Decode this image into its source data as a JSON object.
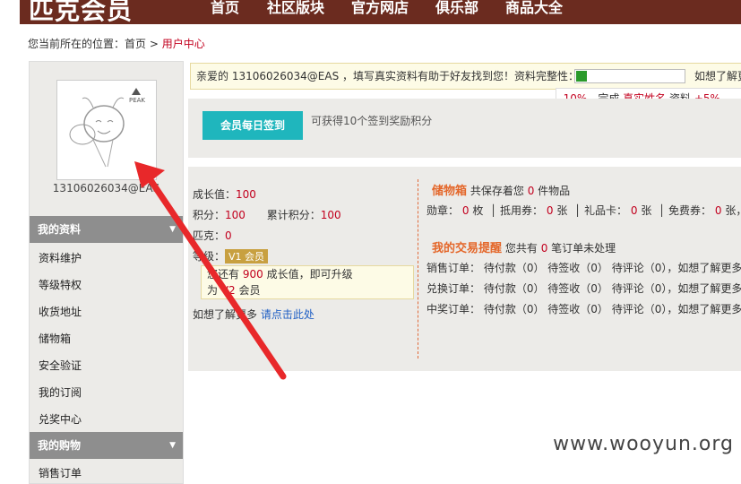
{
  "header": {
    "logo": "匹克会员",
    "nav": [
      "首页",
      "社区版块",
      "官方网店",
      "俱乐部",
      "商品大全"
    ]
  },
  "breadcrumb": {
    "prefix": "您当前所在的位置：",
    "home": "首页",
    "sep": " > ",
    "current": "用户中心"
  },
  "sidebar": {
    "username": "13106026034@EAS",
    "sections": [
      {
        "title": "我的资料",
        "items": [
          "资料维护",
          "等级特权",
          "收货地址",
          "储物箱",
          "安全验证",
          "我的订阅",
          "兑奖中心"
        ]
      },
      {
        "title": "我的购物",
        "items": [
          "销售订单"
        ]
      }
    ]
  },
  "notice": {
    "text": "亲爱的 13106026034@EAS ，填写真实资料有助于好友找到您！资料完整性：",
    "progress": 0.1,
    "more": "如想了解更",
    "tip_pct": "10%",
    "tip_mid": "，完成",
    "tip_field": "真实姓名",
    "tip_word": "资料",
    "tip_plus": "+5%"
  },
  "signin": {
    "button": "会员每日签到",
    "note": "可获得10个签到奖励积分"
  },
  "stats": {
    "growth_label": "成长值：",
    "growth": "100",
    "points_label": "积分：",
    "points": "100",
    "total_label": "累计积分：",
    "total": "100",
    "peak_label": "匹克：",
    "peak": "0",
    "level_label": "等级：",
    "level_badge": "V1 会员",
    "hint_a": "您还有",
    "hint_num": "900",
    "hint_b": "成长值，即可升级",
    "hint_c": "为",
    "hint_v": "V2",
    "hint_d": "会员",
    "more_text": "如想了解更多",
    "more_link": "请点击此处"
  },
  "storage": {
    "title": "储物箱",
    "desc_a": "共保存着您",
    "count": "0",
    "desc_b": "件物品",
    "line": [
      {
        "label": "勋章：",
        "val": "0",
        "unit": "枚"
      },
      {
        "label": "抵用券：",
        "val": "0",
        "unit": "张"
      },
      {
        "label": "礼品卡：",
        "val": "0",
        "unit": "张"
      },
      {
        "label": "免费券：",
        "val": "0",
        "unit": "张，如"
      }
    ]
  },
  "orders": {
    "title": "我的交易提醒",
    "desc_a": "您共有",
    "count": "0",
    "desc_b": "笔订单未处理",
    "rows": [
      {
        "label": "销售订单：",
        "seg": "待付款（0） 待签收（0） 待评论（0），如想了解更多"
      },
      {
        "label": "兑换订单：",
        "seg": "待付款（0） 待签收（0） 待评论（0），如想了解更多"
      },
      {
        "label": "中奖订单：",
        "seg": "待付款（0） 待签收（0） 待评论（0），如想了解更多"
      }
    ]
  },
  "watermark": "www.wooyun.org"
}
